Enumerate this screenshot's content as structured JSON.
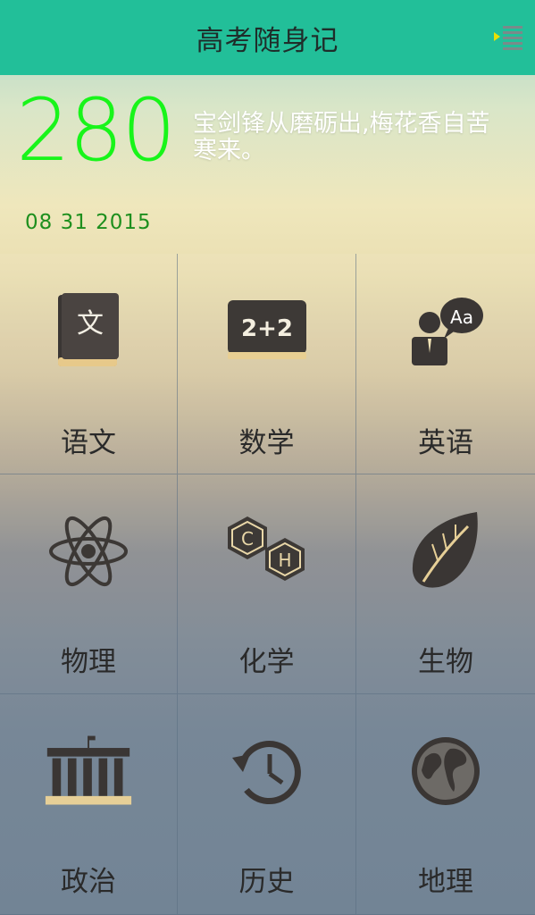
{
  "header": {
    "title": "高考随身记",
    "menu_icon": "menu-list-icon",
    "accent_color": "#22bf99"
  },
  "hero": {
    "countdown": "280",
    "date": "08 31 2015",
    "quote": "宝剑锋从磨砺出,梅花香自苦寒来。",
    "countdown_color": "#18f51a"
  },
  "subjects": [
    {
      "label": "语文",
      "icon": "chinese-book-icon"
    },
    {
      "label": "数学",
      "icon": "math-chalkboard-icon"
    },
    {
      "label": "英语",
      "icon": "english-speaker-icon"
    },
    {
      "label": "物理",
      "icon": "atom-icon"
    },
    {
      "label": "化学",
      "icon": "chemistry-hexagon-icon"
    },
    {
      "label": "生物",
      "icon": "leaf-icon"
    },
    {
      "label": "政治",
      "icon": "government-building-icon"
    },
    {
      "label": "历史",
      "icon": "history-clock-icon"
    },
    {
      "label": "地理",
      "icon": "globe-icon"
    }
  ],
  "icon_text": {
    "wen": "文",
    "math": "2+2",
    "aa": "Aa",
    "c": "C",
    "h": "H"
  }
}
